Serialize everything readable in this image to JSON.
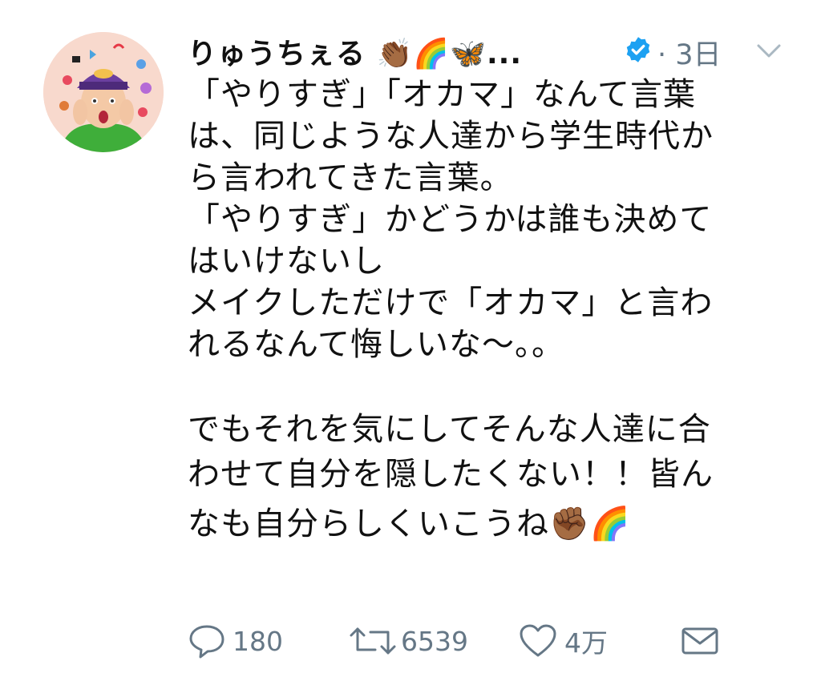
{
  "user": {
    "display_name": "りゅうちぇる 👏🏾🌈🦋...",
    "verified": true
  },
  "time": "· 3日",
  "tweet_lines": [
    "「やりすぎ」「オカマ」なんて言葉",
    "は、同じような人達から学生時代か",
    "ら言われてきた言葉。",
    "「やりすぎ」かどうかは誰も決めて",
    "はいけないし",
    "メイクしただけで「オカマ」と言わ",
    "れるなんて悔しいな〜。。"
  ],
  "tweet_lines_2": [
    "でもそれを気にしてそんな人達に合",
    "わせて自分を隠したくない！！皆ん",
    "なも自分らしくいこうね✊🏾🌈"
  ],
  "actions": {
    "reply_count": "180",
    "retweet_count": "6539",
    "like_count": "4万"
  },
  "colors": {
    "verified": "#1da1f2",
    "meta": "#657786",
    "text": "#111111"
  },
  "icons": {
    "reply": "reply-icon",
    "retweet": "retweet-icon",
    "like": "heart-icon",
    "dm": "envelope-icon",
    "menu": "chevron-down-icon",
    "verified": "verified-badge-icon"
  }
}
